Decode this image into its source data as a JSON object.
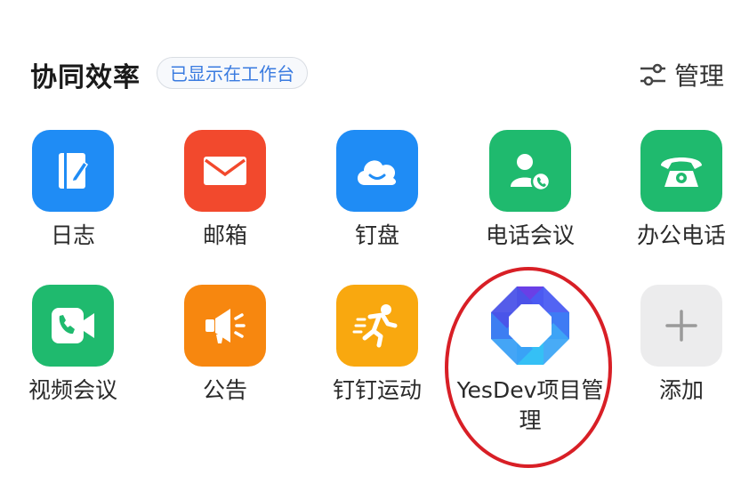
{
  "header": {
    "title": "协同效率",
    "badge": "已显示在工作台",
    "manage_label": "管理"
  },
  "apps": [
    {
      "label": "日志",
      "icon": "journal-icon",
      "color": "#1f8cf5"
    },
    {
      "label": "邮箱",
      "icon": "mail-icon",
      "color": "#f2492d"
    },
    {
      "label": "钉盘",
      "icon": "cloud-icon",
      "color": "#1f8cf5"
    },
    {
      "label": "电话会议",
      "icon": "conference-call-icon",
      "color": "#1fba6e"
    },
    {
      "label": "办公电话",
      "icon": "telephone-icon",
      "color": "#1fba6e"
    },
    {
      "label": "视频会议",
      "icon": "video-call-icon",
      "color": "#1fba6e"
    },
    {
      "label": "公告",
      "icon": "megaphone-icon",
      "color": "#f7870f"
    },
    {
      "label": "钉钉运动",
      "icon": "running-icon",
      "color": "#f9a80f"
    },
    {
      "label": "YesDev项目管理",
      "icon": "yesdev-logo-icon",
      "color": "#4a6cf0"
    },
    {
      "label": "添加",
      "icon": "plus-icon",
      "color": "#ececed"
    }
  ],
  "highlight": {
    "color": "#d81f26"
  }
}
